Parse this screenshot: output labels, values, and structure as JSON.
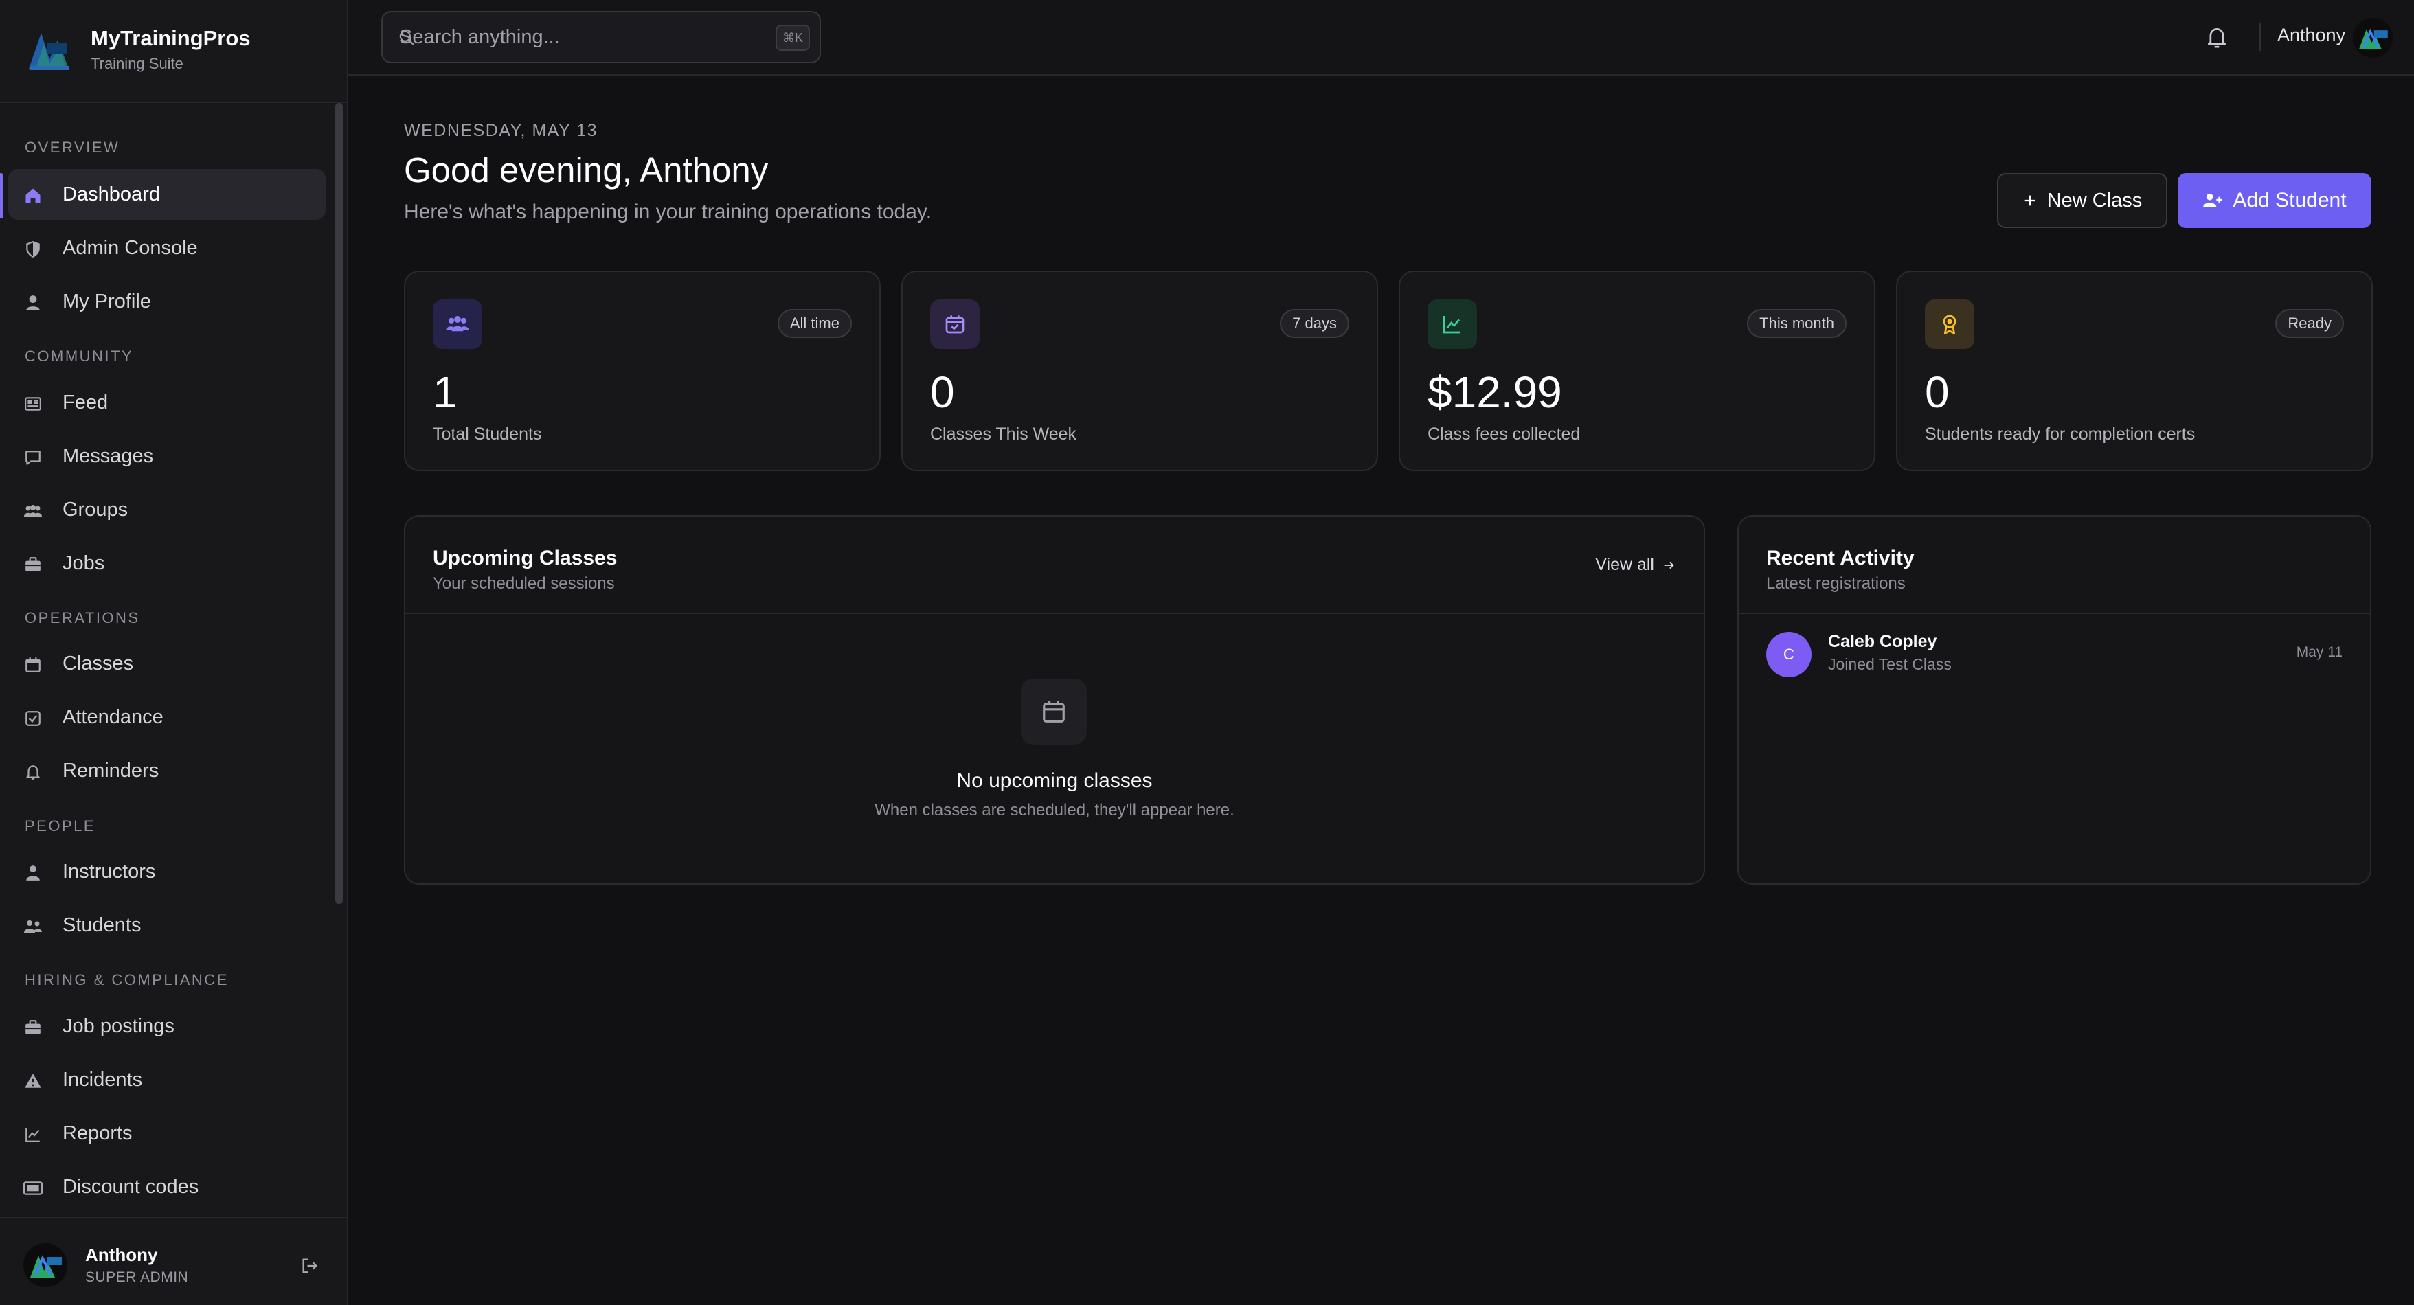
{
  "app": {
    "name": "MyTrainingPros",
    "subtitle": "Training Suite"
  },
  "sidebar": {
    "sections": [
      {
        "title": "OVERVIEW"
      },
      {
        "title": "COMMUNITY"
      },
      {
        "title": "OPERATIONS"
      },
      {
        "title": "PEOPLE"
      },
      {
        "title": "HIRING & COMPLIANCE"
      }
    ],
    "items": [
      {
        "label": "Dashboard",
        "icon": "home-icon",
        "active": true
      },
      {
        "label": "Admin Console",
        "icon": "shield-icon"
      },
      {
        "label": "My Profile",
        "icon": "user-icon"
      },
      {
        "label": "Feed",
        "icon": "newspaper-icon"
      },
      {
        "label": "Messages",
        "icon": "message-icon"
      },
      {
        "label": "Groups",
        "icon": "users-icon"
      },
      {
        "label": "Jobs",
        "icon": "briefcase-icon"
      },
      {
        "label": "Classes",
        "icon": "calendar-icon"
      },
      {
        "label": "Attendance",
        "icon": "checkbox-icon"
      },
      {
        "label": "Reminders",
        "icon": "bell-icon"
      },
      {
        "label": "Instructors",
        "icon": "person-icon"
      },
      {
        "label": "Students",
        "icon": "users-icon"
      },
      {
        "label": "Job postings",
        "icon": "briefcase-icon"
      },
      {
        "label": "Incidents",
        "icon": "warning-icon"
      },
      {
        "label": "Reports",
        "icon": "chart-icon"
      },
      {
        "label": "Discount codes",
        "icon": "ticket-icon"
      }
    ],
    "user": {
      "name": "Anthony",
      "role": "SUPER ADMIN"
    }
  },
  "topbar": {
    "search_placeholder": "Search anything...",
    "shortcut": "⌘K",
    "user_name": "Anthony"
  },
  "header": {
    "date": "WEDNESDAY, MAY 13",
    "greeting": "Good evening, Anthony",
    "subtitle": "Here's what's happening in your training operations today.",
    "new_class_label": "New Class",
    "add_student_label": "Add Student"
  },
  "stats": [
    {
      "value": "1",
      "label": "Total Students",
      "badge": "All time",
      "icon": "users-icon",
      "color": "#8b7cf6"
    },
    {
      "value": "0",
      "label": "Classes This Week",
      "badge": "7 days",
      "icon": "calendar-check-icon",
      "color": "#a78bfa"
    },
    {
      "value": "$12.99",
      "label": "Class fees collected",
      "badge": "This month",
      "icon": "trend-icon",
      "color": "#34d399"
    },
    {
      "value": "0",
      "label": "Students ready for completion certs",
      "badge": "Ready",
      "icon": "award-icon",
      "color": "#fbbf24"
    }
  ],
  "upcoming": {
    "title": "Upcoming Classes",
    "subtitle": "Your scheduled sessions",
    "view_all": "View all",
    "empty_title": "No upcoming classes",
    "empty_subtitle": "When classes are scheduled, they'll appear here."
  },
  "activity": {
    "title": "Recent Activity",
    "subtitle": "Latest registrations",
    "items": [
      {
        "initial": "C",
        "name": "Caleb Copley",
        "desc": "Joined Test Class",
        "date": "May 11"
      }
    ]
  },
  "colors": {
    "accent": "#6d5ff2",
    "background": "#111114",
    "sidebar": "#18181b"
  }
}
